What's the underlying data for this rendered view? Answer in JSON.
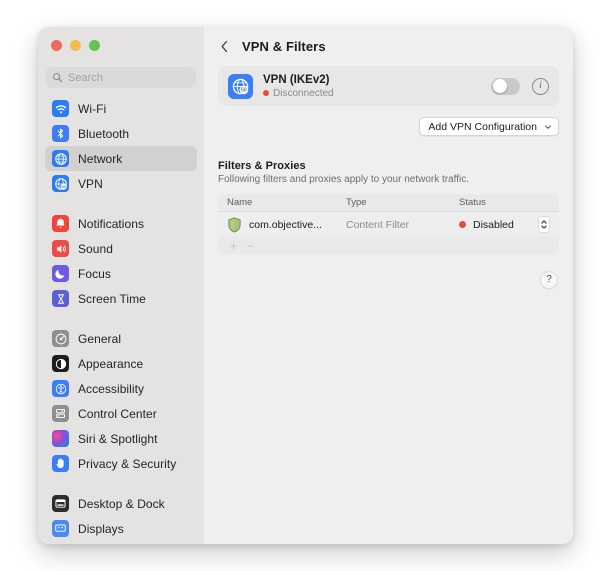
{
  "window": {
    "traffic_lights": [
      {
        "name": "close",
        "color": "#ec6a5f"
      },
      {
        "name": "minimize",
        "color": "#f3bc4f"
      },
      {
        "name": "zoom",
        "color": "#61c454"
      }
    ]
  },
  "sidebar": {
    "search": {
      "placeholder": "Search",
      "value": "",
      "icon": "search-icon"
    },
    "groups": [
      {
        "items": [
          {
            "label": "Wi-Fi",
            "icon": "wifi-icon",
            "selected": false
          },
          {
            "label": "Bluetooth",
            "icon": "bluetooth-icon",
            "selected": false
          },
          {
            "label": "Network",
            "icon": "globe-icon",
            "selected": true
          },
          {
            "label": "VPN",
            "icon": "vpn-globe-icon",
            "selected": false
          }
        ]
      },
      {
        "items": [
          {
            "label": "Notifications",
            "icon": "bell-icon",
            "selected": false
          },
          {
            "label": "Sound",
            "icon": "speaker-icon",
            "selected": false
          },
          {
            "label": "Focus",
            "icon": "moon-icon",
            "selected": false
          },
          {
            "label": "Screen Time",
            "icon": "hourglass-icon",
            "selected": false
          }
        ]
      },
      {
        "items": [
          {
            "label": "General",
            "icon": "gear-icon",
            "selected": false
          },
          {
            "label": "Appearance",
            "icon": "appearance-icon",
            "selected": false
          },
          {
            "label": "Accessibility",
            "icon": "accessibility-icon",
            "selected": false
          },
          {
            "label": "Control Center",
            "icon": "control-center-icon",
            "selected": false
          },
          {
            "label": "Siri & Spotlight",
            "icon": "siri-icon",
            "selected": false
          },
          {
            "label": "Privacy & Security",
            "icon": "hand-icon",
            "selected": false
          }
        ]
      },
      {
        "items": [
          {
            "label": "Desktop & Dock",
            "icon": "desktop-dock-icon",
            "selected": false
          },
          {
            "label": "Displays",
            "icon": "displays-icon",
            "selected": false
          }
        ]
      }
    ]
  },
  "toolbar": {
    "back_icon": "chevron-left-icon",
    "title": "VPN & Filters"
  },
  "vpn_card": {
    "icon": "vpn-globe-icon",
    "name": "VPN (IKEv2)",
    "status": "Disconnected",
    "status_color": "#e84b3c",
    "toggle_on": false,
    "info_icon": "info-icon"
  },
  "add_button": {
    "label": "Add VPN Configuration",
    "chevron_icon": "chevron-down-icon"
  },
  "filters_section": {
    "title": "Filters & Proxies",
    "subtitle": "Following filters and proxies apply to your network traffic.",
    "columns": [
      "Name",
      "Type",
      "Status"
    ],
    "rows": [
      {
        "icon": "shield-icon",
        "name": "com.objective...",
        "type": "Content Filter",
        "status": "Disabled",
        "status_color": "#e84b3c",
        "stepper_icon": "stepper-updown-icon"
      }
    ],
    "footer": {
      "add_label": "+",
      "remove_label": "−"
    }
  },
  "help": {
    "label": "?",
    "name": "help-button"
  }
}
